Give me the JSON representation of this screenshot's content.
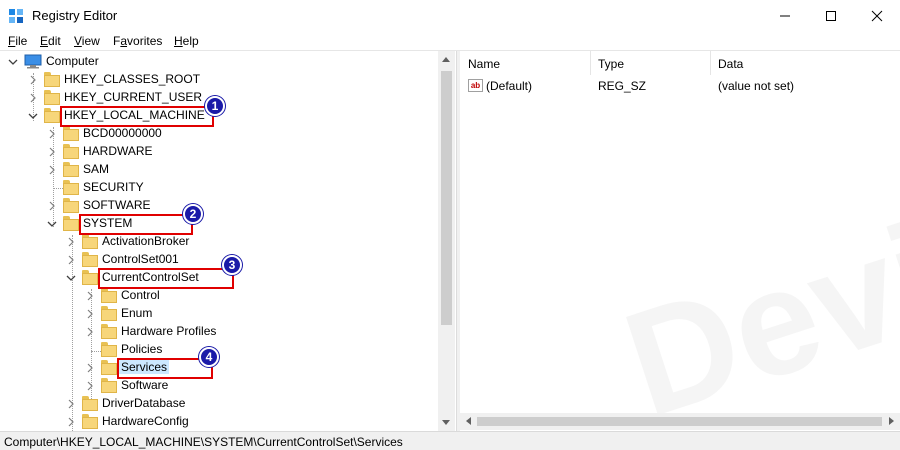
{
  "window": {
    "title": "Registry Editor"
  },
  "menu": {
    "items": [
      {
        "u": "F",
        "rest": "ile"
      },
      {
        "u": "E",
        "rest": "dit"
      },
      {
        "u": "V",
        "rest": "iew"
      },
      {
        "pre": "F",
        "u": "a",
        "rest": "vorites"
      },
      {
        "u": "H",
        "rest": "elp"
      }
    ]
  },
  "tree": {
    "computer": "Computer",
    "hkcr": "HKEY_CLASSES_ROOT",
    "hkcu": "HKEY_CURRENT_USER",
    "hklm": "HKEY_LOCAL_MACHINE",
    "bcd": "BCD00000000",
    "hardware": "HARDWARE",
    "sam": "SAM",
    "security": "SECURITY",
    "software": "SOFTWARE",
    "system": "SYSTEM",
    "activation_broker": "ActivationBroker",
    "controlset001": "ControlSet001",
    "current_control_set": "CurrentControlSet",
    "control": "Control",
    "enum": "Enum",
    "hardware_profiles": "Hardware Profiles",
    "policies": "Policies",
    "services": "Services",
    "software_sub": "Software",
    "driver_database": "DriverDatabase",
    "hardware_config": "HardwareConfig"
  },
  "callouts": [
    "1",
    "2",
    "3",
    "4"
  ],
  "list": {
    "headers": {
      "name": "Name",
      "type": "Type",
      "data": "Data"
    },
    "rows": [
      {
        "name": "(Default)",
        "type": "REG_SZ",
        "data": "(value not set)",
        "icon": "string-value-icon"
      }
    ]
  },
  "status": {
    "path": "Computer\\HKEY_LOCAL_MACHINE\\SYSTEM\\CurrentControlSet\\Services"
  },
  "watermark": "DeviceTricks",
  "colors": {
    "callout_box": "#e00000",
    "badge": "#1a1aa8",
    "selection": "#cce8ff"
  }
}
